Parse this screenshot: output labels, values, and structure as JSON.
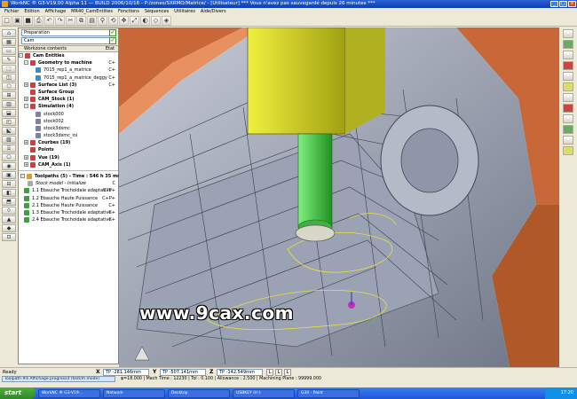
{
  "window": {
    "title": "WorkNC ® G3-V19.00 Alpha 11 — BUILD 2006/10/16 - P:/zones/SXRMO/Matrice/ - [Utilisateur] *** Vous n'avez pas sauvegardé depuis 26 minutes ***",
    "min_label": "_",
    "max_label": "□",
    "close_label": "x"
  },
  "menu": [
    "Fichier",
    "Edition",
    "Affichage",
    "MR40_CamEntities",
    "Fonctions",
    "Séquences",
    "Utilitaires",
    "Aide/Divers"
  ],
  "toolbar_icons": [
    "new-icon",
    "open-icon",
    "save-icon",
    "print-icon",
    "undo-icon",
    "redo-icon",
    "cut-icon",
    "copy-icon",
    "paste-icon",
    "zoom-icon",
    "rotate-icon",
    "pan-icon",
    "fit-icon",
    "shade-icon",
    "wire-icon",
    "view-icon"
  ],
  "toolbar_glyphs": [
    "□",
    "▣",
    "■",
    "⎙",
    "↶",
    "↷",
    "✂",
    "⧉",
    "▤",
    "⚲",
    "⟲",
    "✥",
    "⤢",
    "◐",
    "◇",
    "◈"
  ],
  "left_tools": [
    "⌂",
    "▦",
    "▭",
    "✎",
    "⬚",
    "◫",
    "⬡",
    "⊞",
    "▥",
    "⬓",
    "◰",
    "⬕",
    "▧",
    "⌸",
    "⎔",
    "◉",
    "▣",
    "⊟",
    "◧",
    "⬒",
    "⟐",
    "▲",
    "◆",
    "⊡"
  ],
  "panel": {
    "preparation": "Preparation",
    "cam": "Cam",
    "check": "✓",
    "ws_header": "Workzone contents",
    "ws_status": "Etat",
    "tree": [
      {
        "indent": 4,
        "exp": "–",
        "label": "Cam Entities",
        "status": "",
        "color": "#c84040",
        "bold": true
      },
      {
        "indent": 10,
        "exp": "–",
        "label": "Geometry to machine",
        "status": "C+",
        "color": "#c84040",
        "bold": true
      },
      {
        "indent": 16,
        "exp": "",
        "label": "7015_rep1_a_matrice",
        "status": "C+",
        "color": "#3c8ad0",
        "bold": false
      },
      {
        "indent": 16,
        "exp": "",
        "label": "7015_rep1_a_matrice_deggy",
        "status": "C+",
        "color": "#3c8ad0",
        "bold": false
      },
      {
        "indent": 10,
        "exp": "+",
        "label": "Surface List (3)",
        "status": "C+",
        "color": "#c84040",
        "bold": true
      },
      {
        "indent": 10,
        "exp": "",
        "label": "Surface Group",
        "status": "",
        "color": "#c84040",
        "bold": true
      },
      {
        "indent": 10,
        "exp": "+",
        "label": "CAM_Stock (1)",
        "status": "",
        "color": "#c84040",
        "bold": true
      },
      {
        "indent": 10,
        "exp": "–",
        "label": "Simulation (4)",
        "status": "",
        "color": "#c84040",
        "bold": true
      },
      {
        "indent": 16,
        "exp": "",
        "label": "stock000",
        "status": "",
        "color": "#8080a0",
        "bold": false
      },
      {
        "indent": 16,
        "exp": "",
        "label": "stock002",
        "status": "",
        "color": "#8080a0",
        "bold": false
      },
      {
        "indent": 16,
        "exp": "",
        "label": "stock3dsmc",
        "status": "",
        "color": "#8080a0",
        "bold": false
      },
      {
        "indent": 16,
        "exp": "",
        "label": "stock3dsmc_ini",
        "status": "",
        "color": "#8080a0",
        "bold": false
      },
      {
        "indent": 10,
        "exp": "+",
        "label": "Courbes (19)",
        "status": "",
        "color": "#c84040",
        "bold": true
      },
      {
        "indent": 10,
        "exp": "",
        "label": "Points",
        "status": "",
        "color": "#c84040",
        "bold": true
      },
      {
        "indent": 10,
        "exp": "+",
        "label": "Vue (19)",
        "status": "",
        "color": "#c84040",
        "bold": true
      },
      {
        "indent": 10,
        "exp": "+",
        "label": "CAM_Axis (1)",
        "status": "",
        "color": "#c84040",
        "bold": true
      }
    ],
    "toolpaths_header": "Toolpaths (5) - Time : 546 h 35 mn",
    "toolpaths": [
      {
        "indent": 10,
        "label": "Stock model - Initialize",
        "status": "C",
        "italic": true
      },
      {
        "indent": 6,
        "label": "1.1 Ebauche Trochoidale adaptative",
        "status": "C?P+",
        "italic": false
      },
      {
        "indent": 6,
        "label": "1.2 Ebauche Haute Puissance",
        "status": "C+P+",
        "italic": false
      },
      {
        "indent": 6,
        "label": "2.1 Ebauche Haute Puissance",
        "status": "C+",
        "italic": false
      },
      {
        "indent": 6,
        "label": "1.3 Ebauche Trochoidale adaptative",
        "status": "C+",
        "italic": false
      },
      {
        "indent": 6,
        "label": "2.4 Ebauche Trochoidale adaptative",
        "status": "C+",
        "italic": false
      }
    ]
  },
  "watermark": "www.9cax.com",
  "status": {
    "ready": "Ready",
    "x_label": "X",
    "x_value": "TP -281.146mm",
    "y_label": "Y",
    "y_value": "TP -507.141mm",
    "z_label": "Z",
    "z_value": "TP -142.549mm",
    "l_buttons": [
      "L",
      "L",
      "L"
    ],
    "message": "Toolpath #4 Affichage progressif (test/m mode)",
    "machining": "φ=18.000 | Mach Time : 12230 | Tol : 0.100 | Allowance : 2.500 | Machining Plane : 99999.000"
  },
  "taskbar": {
    "start": "start",
    "tasks": [
      "WorkNC ® G3-V19...",
      "Network",
      "Desktop",
      "USBKEY (H:)",
      "G30 - Paint"
    ],
    "clock": "17:20"
  },
  "colors": {
    "tool_holder": "#e0e020",
    "tool_green": "#40c040",
    "part_gray": "#a0a8b8",
    "stock_brown": "#c86030"
  }
}
